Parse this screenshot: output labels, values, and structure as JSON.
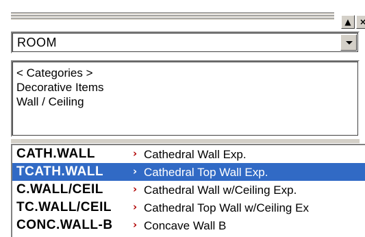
{
  "titlebar": {
    "buttons": [
      {
        "label": "▲",
        "icon": "scroll-up-icon"
      },
      {
        "label": "×",
        "icon": "close-icon"
      }
    ]
  },
  "combo": {
    "value": "ROOM",
    "icon": "chevron-down-icon"
  },
  "categories": [
    {
      "label": "< Categories >"
    },
    {
      "label": "Decorative Items"
    },
    {
      "label": "Wall / Ceiling"
    }
  ],
  "items": [
    {
      "code": "CATH.WALL",
      "description": "Cathedral Wall Exp.",
      "selected": false
    },
    {
      "code": "TCATH.WALL",
      "description": "Cathedral Top Wall Exp.",
      "selected": true
    },
    {
      "code": "C.WALL/CEIL",
      "description": "Cathedral Wall w/Ceiling Exp.",
      "selected": false
    },
    {
      "code": "TC.WALL/CEIL",
      "description": "Cathedral Top Wall w/Ceiling Ex",
      "selected": false
    },
    {
      "code": "CONC.WALL-B",
      "description": "Concave Wall B",
      "selected": false
    }
  ],
  "colors": {
    "selection": "#316ac5",
    "chevron": "#b00000",
    "chrome": "#d4d0c8"
  }
}
